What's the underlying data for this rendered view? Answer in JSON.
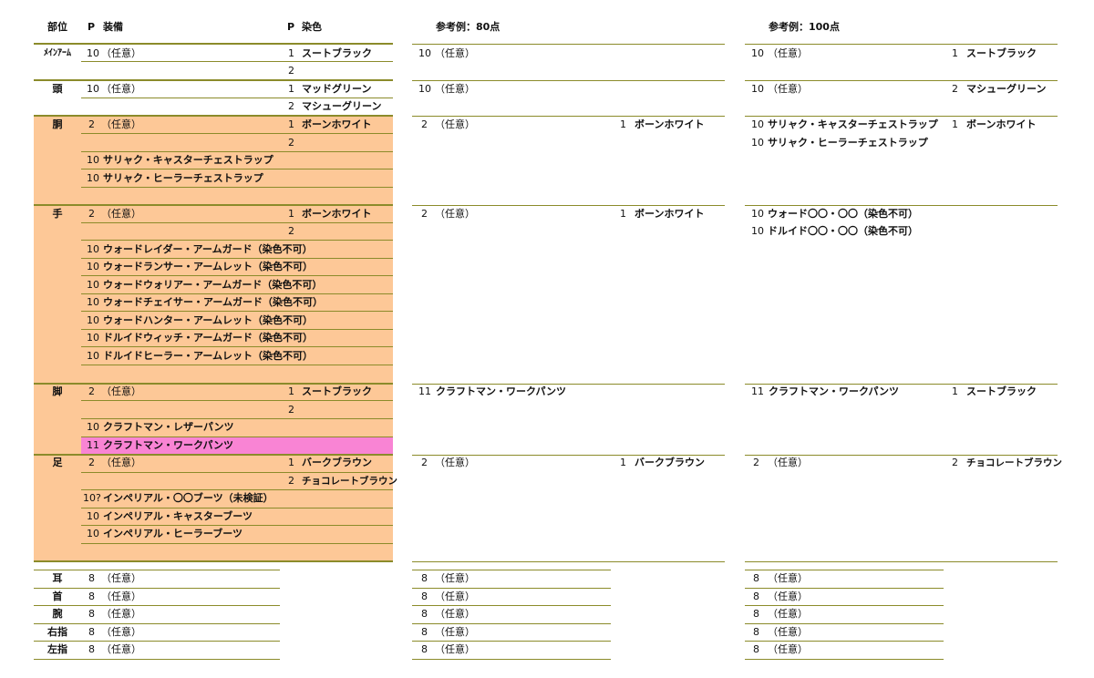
{
  "header": {
    "part": "部位",
    "p1": "P",
    "equip": "装備",
    "p2": "P",
    "dye": "染色",
    "ref80": "参考例：80点",
    "ref100": "参考例：100点"
  },
  "colors": {
    "orange": "#fdc897",
    "pink": "#f984d4",
    "line": "#8b8b2a"
  },
  "main": {
    "mainarm": {
      "part": "ﾒｲﾝｱｰﾑ",
      "rows": [
        {
          "p": "10",
          "name": "（任意）",
          "dp": "1",
          "dye": "スートブラック"
        },
        {
          "dp": "2"
        }
      ]
    },
    "head": {
      "part": "頭",
      "rows": [
        {
          "p": "10",
          "name": "（任意）",
          "dp": "1",
          "dye": "マッドグリーン"
        },
        {
          "dp": "2",
          "dye": "マシューグリーン"
        }
      ]
    },
    "body": {
      "part": "胴",
      "rows": [
        {
          "p": "2",
          "name": "（任意）",
          "dp": "1",
          "dye": "ボーンホワイト"
        },
        {
          "dp": "2"
        },
        {
          "p": "10",
          "name": "サリャク・キャスターチェストラップ"
        },
        {
          "p": "10",
          "name": "サリャク・ヒーラーチェストラップ"
        }
      ]
    },
    "hands": {
      "part": "手",
      "rows": [
        {
          "p": "2",
          "name": "（任意）",
          "dp": "1",
          "dye": "ボーンホワイト"
        },
        {
          "dp": "2"
        },
        {
          "p": "10",
          "name": "ウォードレイダー・アームガード（染色不可）"
        },
        {
          "p": "10",
          "name": "ウォードランサー・アームレット（染色不可）"
        },
        {
          "p": "10",
          "name": "ウォードウォリアー・アームガード（染色不可）"
        },
        {
          "p": "10",
          "name": "ウォードチェイサー・アームガード（染色不可）"
        },
        {
          "p": "10",
          "name": "ウォードハンター・アームレット（染色不可）"
        },
        {
          "p": "10",
          "name": "ドルイドウィッチ・アームガード（染色不可）"
        },
        {
          "p": "10",
          "name": "ドルイドヒーラー・アームレット（染色不可）"
        }
      ]
    },
    "legs": {
      "part": "脚",
      "rows": [
        {
          "p": "2",
          "name": "（任意）",
          "dp": "1",
          "dye": "スートブラック"
        },
        {
          "dp": "2"
        },
        {
          "p": "10",
          "name": "クラフトマン・レザーパンツ"
        },
        {
          "p": "11",
          "name": "クラフトマン・ワークパンツ"
        }
      ]
    },
    "feet": {
      "part": "足",
      "rows": [
        {
          "p": "2",
          "name": "（任意）",
          "dp": "1",
          "dye": "バークブラウン"
        },
        {
          "dp": "2",
          "dye": "チョコレートブラウン"
        },
        {
          "p": "10?",
          "name": "インペリアル・〇〇ブーツ（未検証）"
        },
        {
          "p": "10",
          "name": "インペリアル・キャスターブーツ"
        },
        {
          "p": "10",
          "name": "インペリアル・ヒーラーブーツ"
        }
      ]
    },
    "acc": [
      {
        "part": "耳",
        "p": "8",
        "name": "（任意）"
      },
      {
        "part": "首",
        "p": "8",
        "name": "（任意）"
      },
      {
        "part": "腕",
        "p": "8",
        "name": "（任意）"
      },
      {
        "part": "右指",
        "p": "8",
        "name": "（任意）"
      },
      {
        "part": "左指",
        "p": "8",
        "name": "（任意）"
      }
    ]
  },
  "ref80": {
    "mainarm": {
      "p": "10",
      "name": "（任意）"
    },
    "head": {
      "p": "10",
      "name": "（任意）"
    },
    "body": {
      "p": "2",
      "name": "（任意）",
      "dp": "1",
      "dye": "ボーンホワイト"
    },
    "hands": {
      "p": "2",
      "name": "（任意）",
      "dp": "1",
      "dye": "ボーンホワイト"
    },
    "legs": {
      "p": "11",
      "name": "クラフトマン・ワークパンツ"
    },
    "feet": {
      "p": "2",
      "name": "（任意）",
      "dp": "1",
      "dye": "バークブラウン"
    },
    "acc": [
      {
        "p": "8",
        "name": "（任意）"
      },
      {
        "p": "8",
        "name": "（任意）"
      },
      {
        "p": "8",
        "name": "（任意）"
      },
      {
        "p": "8",
        "name": "（任意）"
      },
      {
        "p": "8",
        "name": "（任意）"
      }
    ]
  },
  "ref100": {
    "mainarm": {
      "p": "10",
      "name": "（任意）",
      "dp": "1",
      "dye": "スートブラック"
    },
    "head": {
      "p": "10",
      "name": "（任意）",
      "dp": "2",
      "dye": "マシューグリーン"
    },
    "body": [
      {
        "p": "10",
        "name": "サリャク・キャスターチェストラップ",
        "dp": "1",
        "dye": "ボーンホワイト"
      },
      {
        "p": "10",
        "name": "サリャク・ヒーラーチェストラップ"
      }
    ],
    "hands": [
      {
        "p": "10",
        "name": "ウォード〇〇・〇〇（染色不可）"
      },
      {
        "p": "10",
        "name": "ドルイド〇〇・〇〇（染色不可）"
      }
    ],
    "legs": {
      "p": "11",
      "name": "クラフトマン・ワークパンツ",
      "dp": "1",
      "dye": "スートブラック"
    },
    "feet": {
      "p": "2",
      "name": "（任意）",
      "dp": "2",
      "dye": "チョコレートブラウン"
    },
    "acc": [
      {
        "p": "8",
        "name": "（任意）"
      },
      {
        "p": "8",
        "name": "（任意）"
      },
      {
        "p": "8",
        "name": "（任意）"
      },
      {
        "p": "8",
        "name": "（任意）"
      },
      {
        "p": "8",
        "name": "（任意）"
      }
    ]
  }
}
